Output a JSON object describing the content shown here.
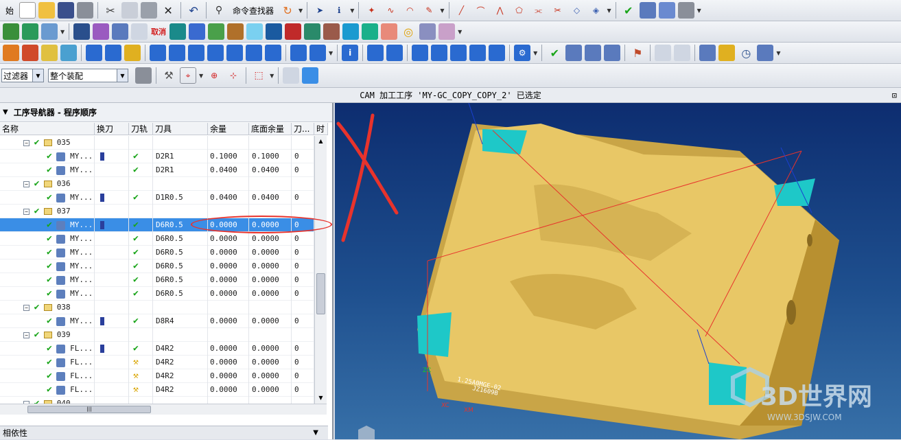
{
  "toolbar1": {
    "start_label": "始",
    "cmd_finder_label": "命令查找器"
  },
  "toolbar4": {
    "filter_value": "过滤器",
    "assembly_value": "整个装配"
  },
  "status": {
    "message": "CAM 加工工序 'MY-GC_COPY_COPY_2' 已选定"
  },
  "navigator": {
    "title": "工序导航器 - 程序顺序",
    "columns": [
      "名称",
      "换刀",
      "刀轨",
      "刀具",
      "余量",
      "底面余量",
      "刀...",
      "时"
    ],
    "rows": [
      {
        "type": "group",
        "name": "035"
      },
      {
        "type": "op",
        "name": "MY...",
        "toolchange": true,
        "path": "check",
        "tool": "D2R1",
        "stock": "0.1000",
        "floor": "0.1000",
        "n": "0"
      },
      {
        "type": "op",
        "name": "MY...",
        "toolchange": false,
        "path": "check",
        "tool": "D2R1",
        "stock": "0.0400",
        "floor": "0.0400",
        "n": "0"
      },
      {
        "type": "group",
        "name": "036"
      },
      {
        "type": "op",
        "name": "MY...",
        "toolchange": true,
        "path": "check",
        "tool": "D1R0.5",
        "stock": "0.0400",
        "floor": "0.0400",
        "n": "0"
      },
      {
        "type": "group",
        "name": "037"
      },
      {
        "type": "op",
        "name": "MY...",
        "toolchange": true,
        "path": "check",
        "tool": "D6R0.5",
        "stock": "0.0000",
        "floor": "0.0000",
        "n": "0",
        "selected": true
      },
      {
        "type": "op",
        "name": "MY...",
        "toolchange": false,
        "path": "check",
        "tool": "D6R0.5",
        "stock": "0.0000",
        "floor": "0.0000",
        "n": "0"
      },
      {
        "type": "op",
        "name": "MY...",
        "toolchange": false,
        "path": "check",
        "tool": "D6R0.5",
        "stock": "0.0000",
        "floor": "0.0000",
        "n": "0"
      },
      {
        "type": "op",
        "name": "MY...",
        "toolchange": false,
        "path": "check",
        "tool": "D6R0.5",
        "stock": "0.0000",
        "floor": "0.0000",
        "n": "0"
      },
      {
        "type": "op",
        "name": "MY...",
        "toolchange": false,
        "path": "check",
        "tool": "D6R0.5",
        "stock": "0.0000",
        "floor": "0.0000",
        "n": "0"
      },
      {
        "type": "op",
        "name": "MY...",
        "toolchange": false,
        "path": "check",
        "tool": "D6R0.5",
        "stock": "0.0000",
        "floor": "0.0000",
        "n": "0"
      },
      {
        "type": "group",
        "name": "038"
      },
      {
        "type": "op",
        "name": "MY...",
        "toolchange": true,
        "path": "check",
        "tool": "D8R4",
        "stock": "0.0000",
        "floor": "0.0000",
        "n": "0"
      },
      {
        "type": "group",
        "name": "039"
      },
      {
        "type": "op",
        "name": "FL...",
        "toolchange": true,
        "path": "check",
        "tool": "D4R2",
        "stock": "0.0000",
        "floor": "0.0000",
        "n": "0"
      },
      {
        "type": "op",
        "name": "FL...",
        "toolchange": false,
        "path": "wrench",
        "tool": "D4R2",
        "stock": "0.0000",
        "floor": "0.0000",
        "n": "0"
      },
      {
        "type": "op",
        "name": "FL...",
        "toolchange": false,
        "path": "wrench",
        "tool": "D4R2",
        "stock": "0.0000",
        "floor": "0.0000",
        "n": "0"
      },
      {
        "type": "op",
        "name": "FL...",
        "toolchange": false,
        "path": "wrench",
        "tool": "D4R2",
        "stock": "0.0000",
        "floor": "0.0000",
        "n": "0"
      },
      {
        "type": "group",
        "name": "040"
      }
    ]
  },
  "dependencies_label": "相依性",
  "viewport": {
    "part_text_1": "1.25A0MGE-02",
    "part_text_2": "JZ1609B",
    "axis_xc": "XC",
    "axis_xm": "XM",
    "axis_zc": "ZC",
    "watermark_title": "3D世界网",
    "watermark_url": "WWW.3DSJW.COM"
  },
  "colors": {
    "selection": "#3a8ee6",
    "viewport_bg": "#1e4f8e",
    "part": "#e8c766",
    "annotation_red": "#e8332c"
  }
}
